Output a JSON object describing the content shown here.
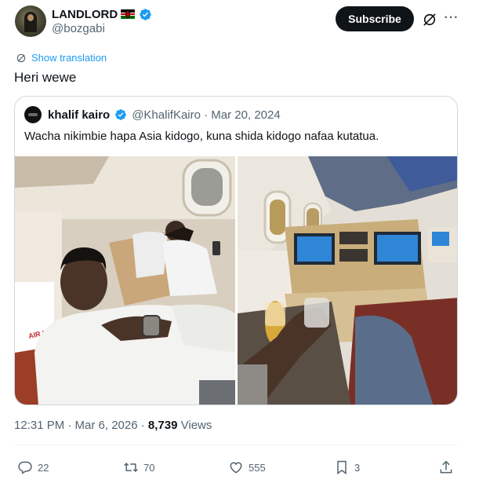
{
  "author": {
    "display_name": "LANDLORD",
    "handle": "@bozgabi"
  },
  "header": {
    "subscribe_label": "Subscribe",
    "more_label": "···"
  },
  "translate": {
    "label": "Show translation"
  },
  "tweet": {
    "text": "Heri wewe"
  },
  "quote": {
    "display_name": "khalif kairo",
    "meta": "@KhalifKairo · Mar 20, 2024",
    "text": "Wacha nikimbie hapa Asia kidogo, kuna shida kidogo nafaa kutatua.",
    "seat_label": "AIR INDIA"
  },
  "meta": {
    "time_date": "12:31 PM · Mar 6, 2026 · ",
    "views_count": "8,739",
    "views_label": " Views"
  },
  "actions": {
    "replies": "22",
    "reposts": "70",
    "likes": "555",
    "bookmarks": "3"
  },
  "colors": {
    "accent": "#1d9bf0",
    "text": "#0f1419",
    "muted": "#536471",
    "border": "#cfd9de",
    "button": "#0f1419"
  }
}
